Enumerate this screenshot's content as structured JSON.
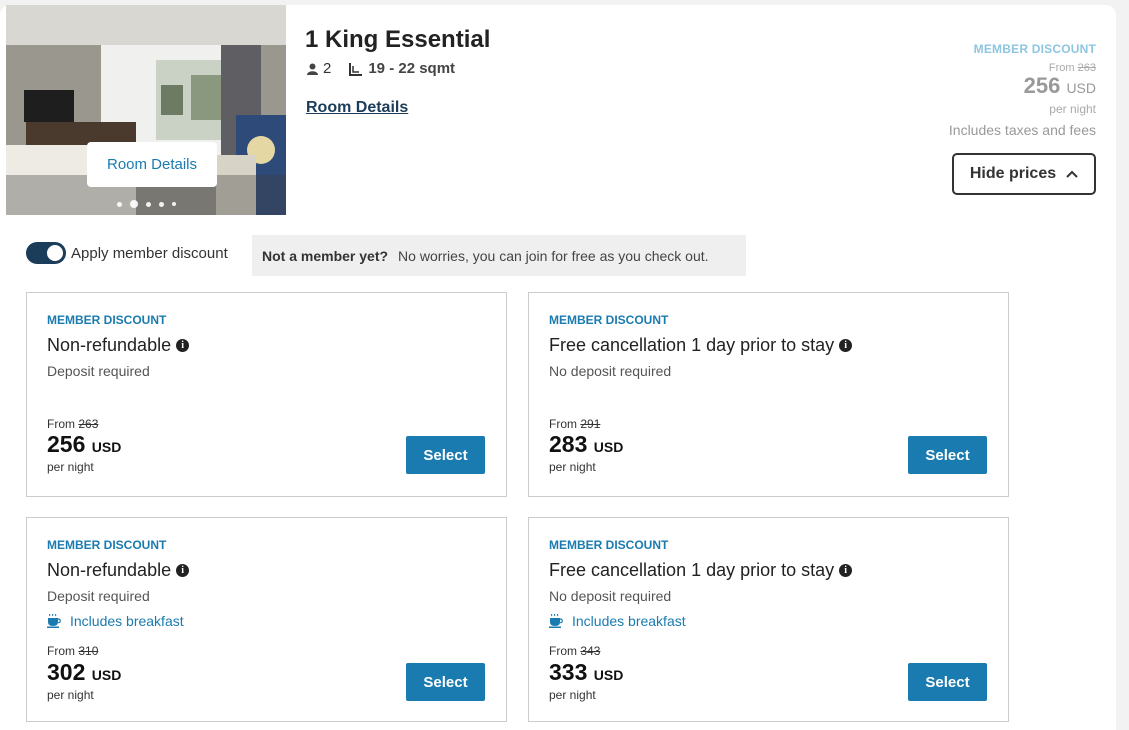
{
  "room": {
    "title": "1 King Essential",
    "guests": "2",
    "size": "19 - 22 sqmt",
    "details_link": "Room Details",
    "photo_button": "Room Details",
    "carousel_dots": 5,
    "carousel_active": 2
  },
  "summary": {
    "badge": "MEMBER DISCOUNT",
    "from_label": "From",
    "old_price": "263",
    "price": "256",
    "currency": "USD",
    "per_night": "per night",
    "taxes": "Includes taxes and fees",
    "hide_prices": "Hide prices"
  },
  "member": {
    "toggle_on": true,
    "toggle_label": "Apply member discount",
    "promo_bold": "Not a member yet?",
    "promo_text": "No worries, you can join for free as you check out."
  },
  "rates": [
    {
      "badge": "MEMBER DISCOUNT",
      "name": "Non-refundable",
      "deposit": "Deposit required",
      "breakfast": "",
      "from_label": "From",
      "old_price": "263",
      "price": "256",
      "currency": "USD",
      "per_night": "per night",
      "select": "Select"
    },
    {
      "badge": "MEMBER DISCOUNT",
      "name": "Free cancellation 1 day prior to stay",
      "deposit": "No deposit required",
      "breakfast": "",
      "from_label": "From",
      "old_price": "291",
      "price": "283",
      "currency": "USD",
      "per_night": "per night",
      "select": "Select"
    },
    {
      "badge": "MEMBER DISCOUNT",
      "name": "Non-refundable",
      "deposit": "Deposit required",
      "breakfast": "Includes breakfast",
      "from_label": "From",
      "old_price": "310",
      "price": "302",
      "currency": "USD",
      "per_night": "per night",
      "select": "Select"
    },
    {
      "badge": "MEMBER DISCOUNT",
      "name": "Free cancellation 1 day prior to stay",
      "deposit": "No deposit required",
      "breakfast": "Includes breakfast",
      "from_label": "From",
      "old_price": "343",
      "price": "333",
      "currency": "USD",
      "per_night": "per night",
      "select": "Select"
    }
  ],
  "colors": {
    "accent": "#1a7bb0",
    "dark": "#1c3d5a",
    "badge_light": "#8ec5e0"
  }
}
